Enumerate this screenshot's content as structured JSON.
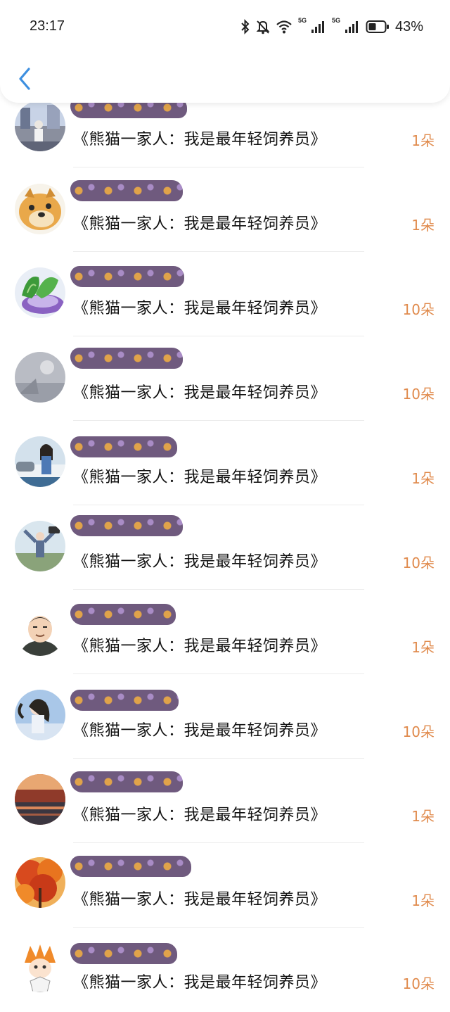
{
  "status_bar": {
    "time": "23:17",
    "battery": "43%",
    "icons": [
      "bluetooth-icon",
      "mute-icon",
      "wifi-icon",
      "signal-5g-icon",
      "signal-5g-icon",
      "battery-icon"
    ],
    "signal_label": "5G"
  },
  "header": {
    "back_icon": "chevron-left-icon",
    "accent_color": "#3d8fe0"
  },
  "colors": {
    "count": "#e08a4c",
    "mask": "#6f5a7e"
  },
  "items": [
    {
      "title": "《熊猫一家人：我是最年轻饲养员》",
      "count": "1朵"
    },
    {
      "title": "《熊猫一家人：我是最年轻饲养员》",
      "count": "1朵"
    },
    {
      "title": "《熊猫一家人：我是最年轻饲养员》",
      "count": "10朵"
    },
    {
      "title": "《熊猫一家人：我是最年轻饲养员》",
      "count": "10朵"
    },
    {
      "title": "《熊猫一家人：我是最年轻饲养员》",
      "count": "1朵"
    },
    {
      "title": "《熊猫一家人：我是最年轻饲养员》",
      "count": "10朵"
    },
    {
      "title": "《熊猫一家人：我是最年轻饲养员》",
      "count": "1朵"
    },
    {
      "title": "《熊猫一家人：我是最年轻饲养员》",
      "count": "10朵"
    },
    {
      "title": "《熊猫一家人：我是最年轻饲养员》",
      "count": "1朵"
    },
    {
      "title": "《熊猫一家人：我是最年轻饲养员》",
      "count": "1朵"
    },
    {
      "title": "《熊猫一家人：我是最年轻饲养员》",
      "count": "10朵"
    }
  ]
}
